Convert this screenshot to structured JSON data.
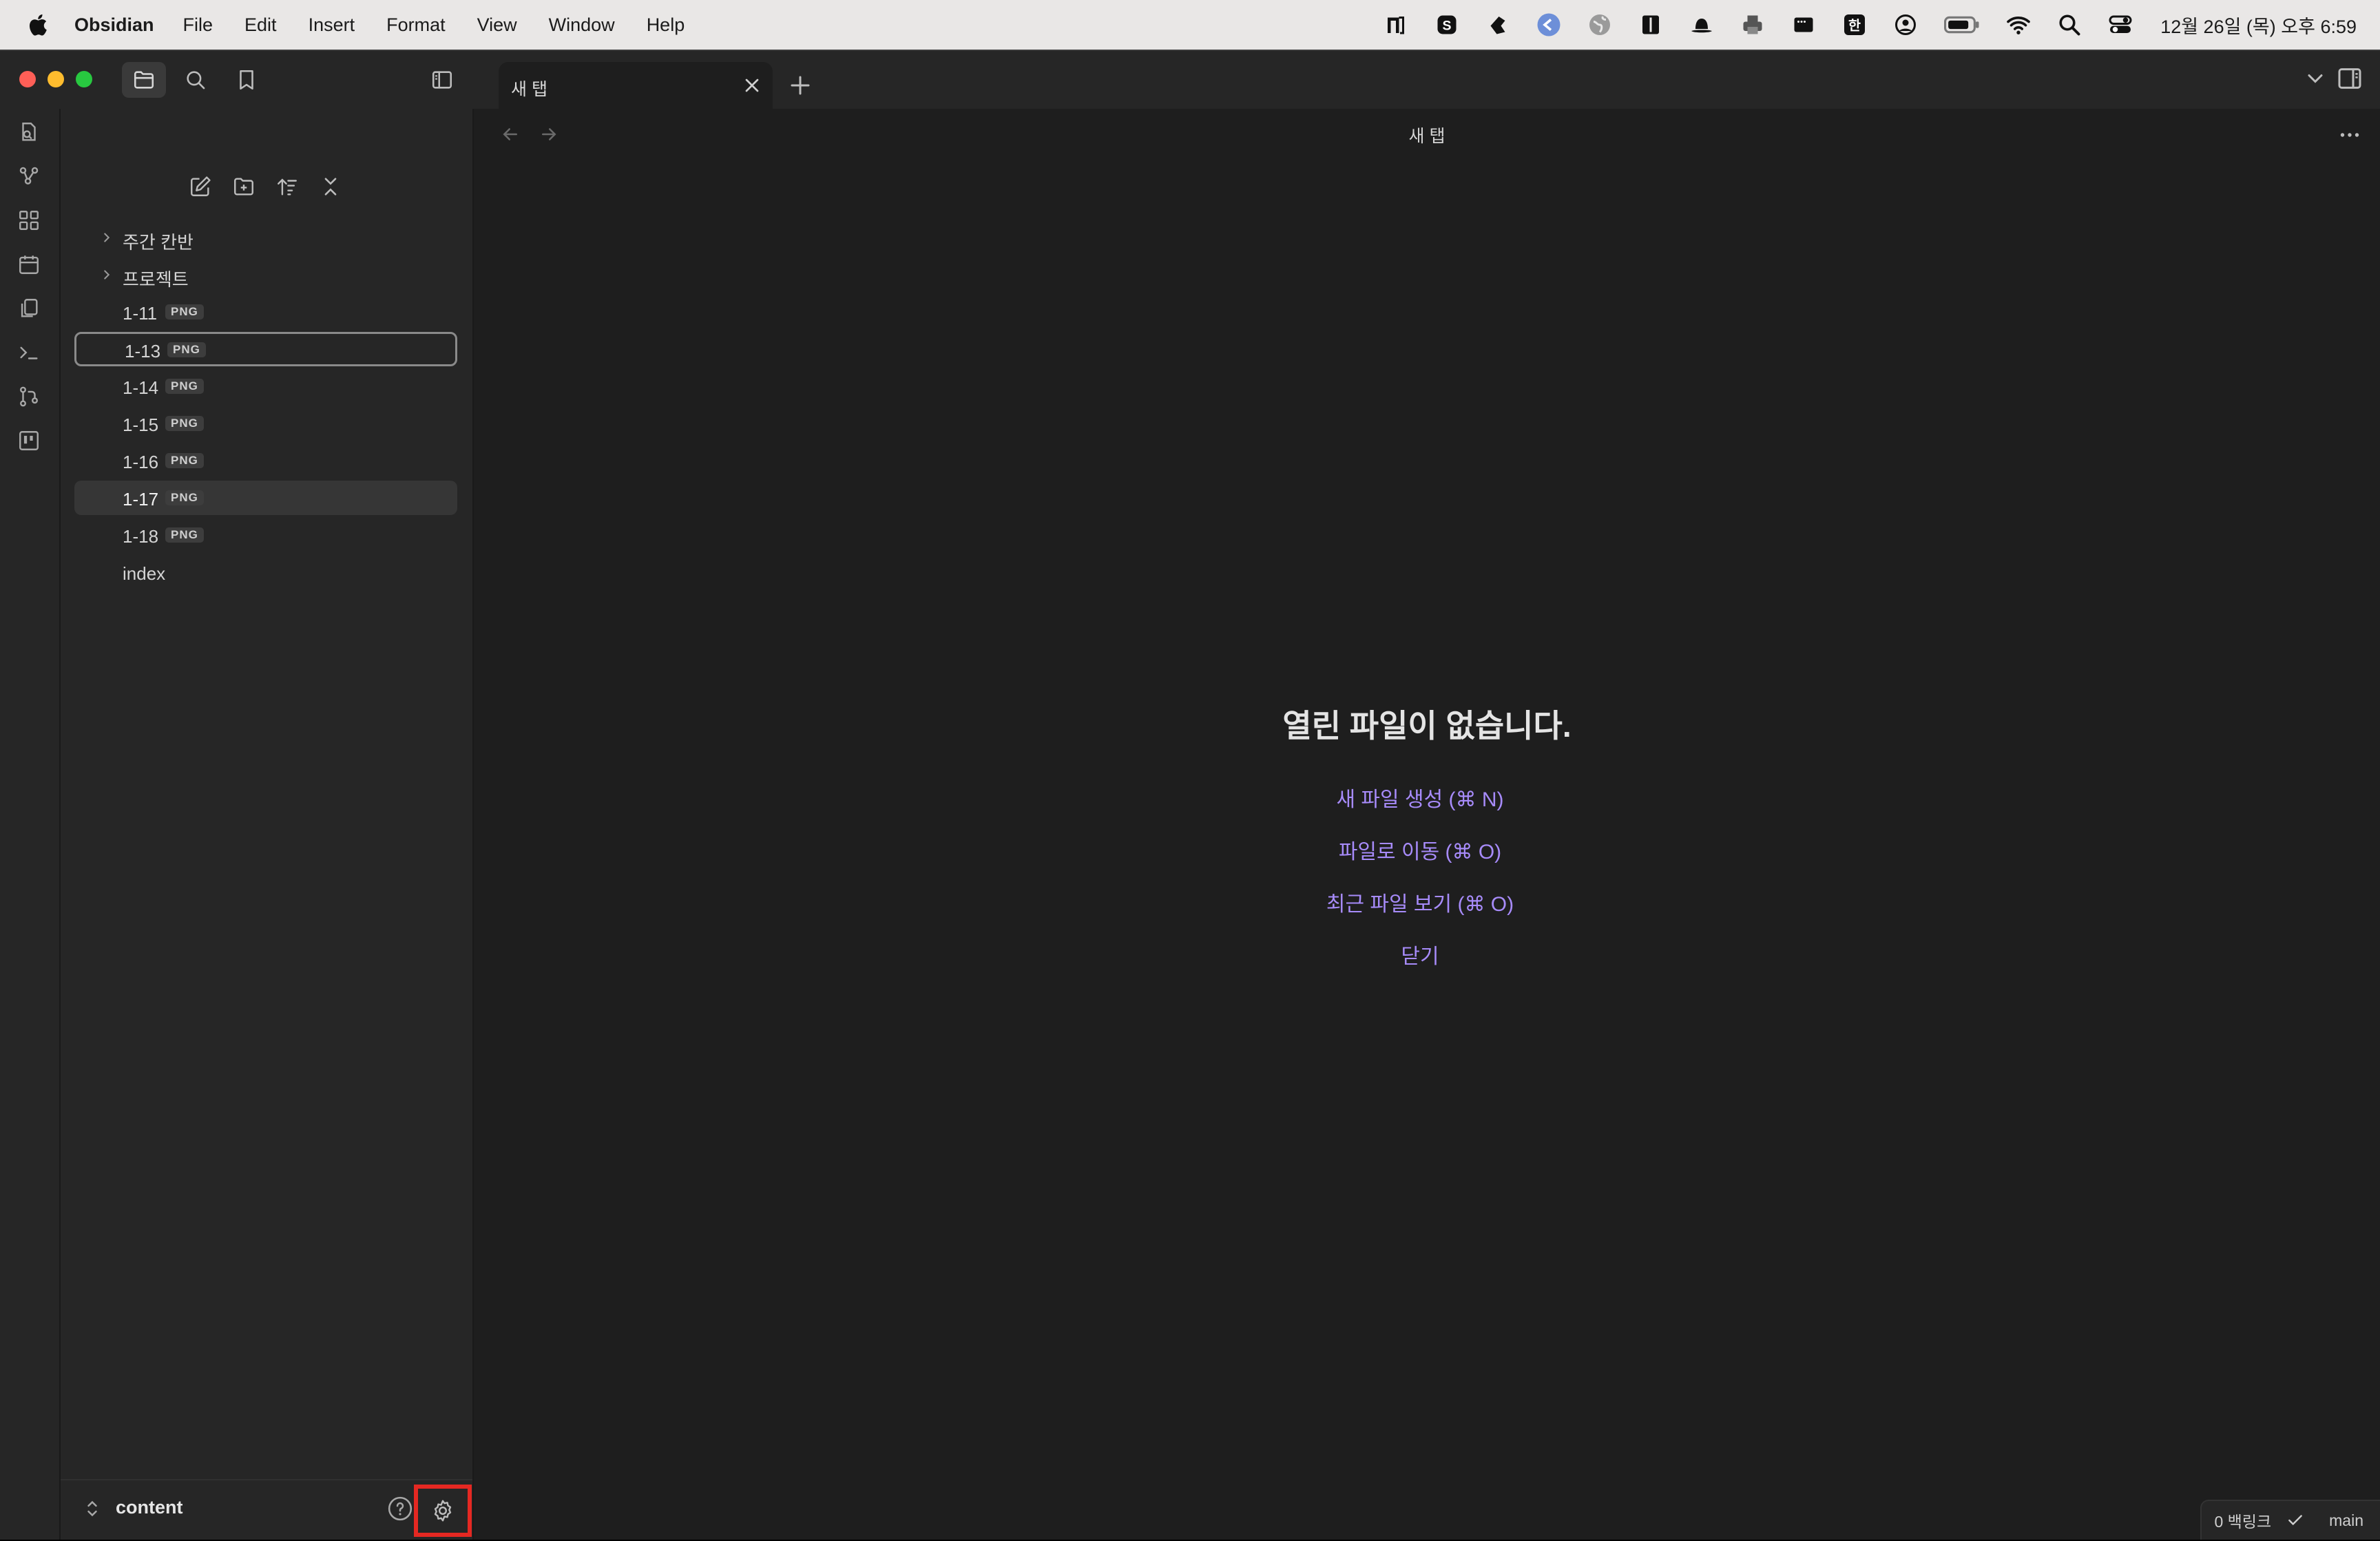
{
  "menubar": {
    "app_name": "Obsidian",
    "menus": [
      "File",
      "Edit",
      "Insert",
      "Format",
      "View",
      "Window",
      "Help"
    ],
    "status_icons": [
      "notion-icon",
      "s-app-icon",
      "scissors-app-icon",
      "back-arrow-app-icon",
      "globe-icon",
      "book-icon",
      "hat-icon",
      "printer-icon",
      "window-icon",
      "korean-input-icon",
      "account-icon",
      "battery-icon",
      "wifi-icon",
      "spotlight-icon",
      "control-center-icon"
    ],
    "input_label": "한",
    "clock": "12월 26일 (목) 오후 6:59"
  },
  "tabs": [
    {
      "title": "새 탭"
    }
  ],
  "sidebar": {
    "tree": [
      {
        "label": "주간 칸반",
        "type": "folder"
      },
      {
        "label": "프로젝트",
        "type": "folder"
      },
      {
        "label": "1-11",
        "badge": "PNG"
      },
      {
        "label": "1-13",
        "badge": "PNG"
      },
      {
        "label": "1-14",
        "badge": "PNG"
      },
      {
        "label": "1-15",
        "badge": "PNG"
      },
      {
        "label": "1-16",
        "badge": "PNG"
      },
      {
        "label": "1-17",
        "badge": "PNG"
      },
      {
        "label": "1-18",
        "badge": "PNG"
      },
      {
        "label": "index"
      }
    ],
    "vault_name": "content"
  },
  "main": {
    "view_title": "새 탭",
    "empty_title": "열린 파일이 없습니다.",
    "actions": [
      "새 파일 생성 (⌘ N)",
      "파일로 이동 (⌘ O)",
      "최근 파일 보기 (⌘ O)",
      "닫기"
    ]
  },
  "statusbar": {
    "backlinks": "0 백링크",
    "branch": "main"
  },
  "colors": {
    "accent": "#a78bfa",
    "highlight_box": "#e52822"
  }
}
